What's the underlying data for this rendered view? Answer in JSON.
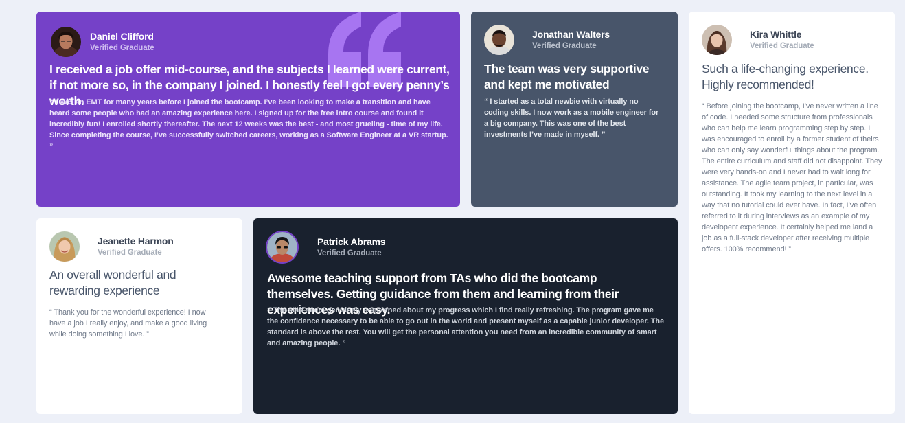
{
  "testimonials": [
    {
      "name": "Daniel Clifford",
      "role": "Verified Graduate",
      "headline": "I received a job offer mid-course, and the subjects I learned were current, if not more so, in the company I joined. I honestly feel I got every penny’s worth.",
      "quote": "“ I was an EMT for many years before I joined the bootcamp. I’ve been looking to make a transition and have heard some people who had an amazing experience here. I signed up for the free intro course and found it incredibly fun! I enrolled shortly thereafter. The next 12 weeks was the best - and most grueling - time of my life. Since completing the course, I’ve successfully switched careers, working as a Software Engineer at a VR startup. ”"
    },
    {
      "name": "Jonathan Walters",
      "role": "Verified Graduate",
      "headline": "The team was very supportive and kept me motivated",
      "quote": "“ I started as a total newbie with virtually no coding skills. I now work as a mobile engineer for a big company. This was one of the best investments I’ve made in myself. ”"
    },
    {
      "name": "Kira Whittle",
      "role": "Verified Graduate",
      "headline": "Such a life-changing experience. Highly recommended!",
      "quote": "“ Before joining the bootcamp, I’ve never written a line of code. I needed some structure from professionals who can help me learn programming step by step. I was encouraged to enroll by a former student of theirs who can only say wonderful things about the program. The entire curriculum and staff did not disappoint. They were very hands-on and I never had to wait long for assistance. The agile team project, in particular, was outstanding. It took my learning to the next level in a way that no tutorial could ever have. In fact, I’ve often referred to it during interviews as an example of my develop​ent experience. It certainly helped me land a job as a full-stack developer after receiving multiple offers. 100% recommend! ”"
    },
    {
      "name": "Jeanette Harmon",
      "role": "Verified Graduate",
      "headline": "An overall wonderful and rewarding experience",
      "quote": "“ Thank you for the wonderful experience! I now have a job I really enjoy, and make a good living while doing something I love. ”"
    },
    {
      "name": "Patrick Abrams",
      "role": "Verified Graduate",
      "headline": "Awesome teaching support from TAs who did the bootcamp themselves. Getting guidance from them and learning from their experiences was easy.",
      "quote": "“ The staff seem genuinely concerned about my progress which I find really refreshing. The program gave me the confidence necessary to be able to go out in the world and present myself as a capable junior developer. The standard is above the rest. You will get the personal attention you need from an incredible community of smart and amazing people. ”"
    }
  ],
  "colors": {
    "page_background": "#edf0f8",
    "purple_card": "#7541c8",
    "grey_card": "#48556a",
    "white_card": "#ffffff",
    "dark_card": "#19212e",
    "quote_mark": "#a775f1"
  },
  "icons": {
    "decoration": "quotation-mark-icon"
  }
}
